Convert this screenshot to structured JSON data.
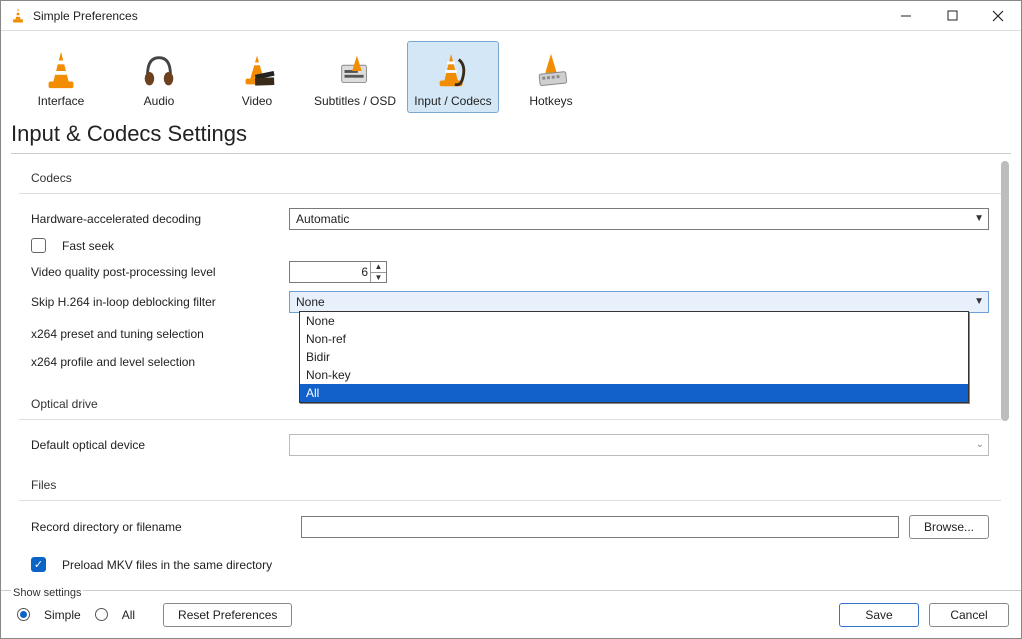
{
  "window": {
    "title": "Simple Preferences"
  },
  "categories": [
    {
      "label": "Interface"
    },
    {
      "label": "Audio"
    },
    {
      "label": "Video"
    },
    {
      "label": "Subtitles / OSD"
    },
    {
      "label": "Input / Codecs"
    },
    {
      "label": "Hotkeys"
    }
  ],
  "page_heading": "Input & Codecs Settings",
  "groups": {
    "codecs": {
      "title": "Codecs",
      "hw_decoding_label": "Hardware-accelerated decoding",
      "hw_decoding_value": "Automatic",
      "fast_seek_label": "Fast seek",
      "vqpp_label": "Video quality post-processing level",
      "vqpp_value": "6",
      "skip_loopfilter_label": "Skip H.264 in-loop deblocking filter",
      "skip_loopfilter_value": "None",
      "skip_loopfilter_options": [
        "None",
        "Non-ref",
        "Bidir",
        "Non-key",
        "All"
      ],
      "x264_preset_label": "x264 preset and tuning selection",
      "x264_profile_label": "x264 profile and level selection"
    },
    "optical": {
      "title": "Optical drive",
      "default_device_label": "Default optical device"
    },
    "files": {
      "title": "Files",
      "record_label": "Record directory or filename",
      "browse_label": "Browse...",
      "preload_mkv_label": "Preload MKV files in the same directory"
    }
  },
  "footer": {
    "show_settings_label": "Show settings",
    "simple_label": "Simple",
    "all_label": "All",
    "reset_label": "Reset Preferences",
    "save_label": "Save",
    "cancel_label": "Cancel"
  }
}
